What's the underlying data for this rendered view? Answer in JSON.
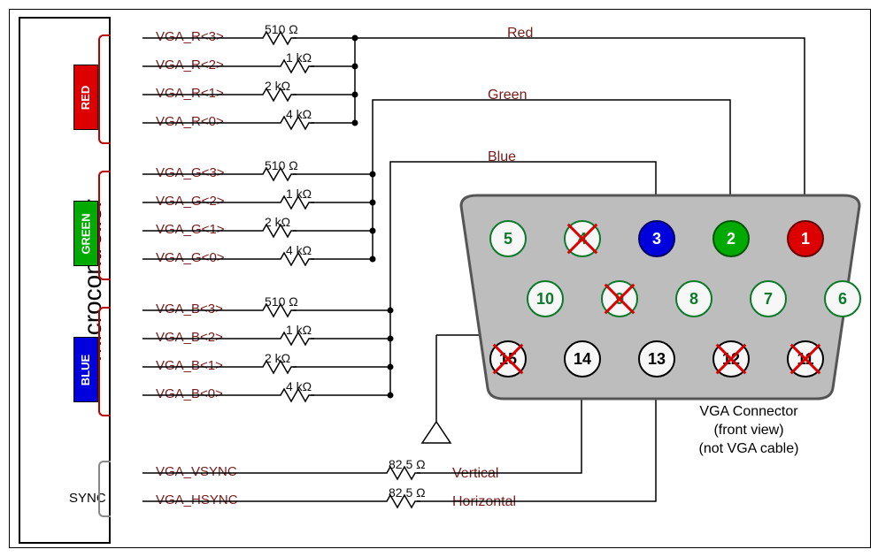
{
  "mcu_label": "microcontroller",
  "sync_label": "SYNC",
  "groups": {
    "red": {
      "badge": "RED"
    },
    "green": {
      "badge": "GREEN"
    },
    "blue": {
      "badge": "BLUE"
    }
  },
  "signals": {
    "r3": "VGA_R<3>",
    "r2": "VGA_R<2>",
    "r1": "VGA_R<1>",
    "r0": "VGA_R<0>",
    "g3": "VGA_G<3>",
    "g2": "VGA_G<2>",
    "g1": "VGA_G<1>",
    "g0": "VGA_G<0>",
    "b3": "VGA_B<3>",
    "b2": "VGA_B<2>",
    "b1": "VGA_B<1>",
    "b0": "VGA_B<0>",
    "vs": "VGA_VSYNC",
    "hs": "VGA_HSYNC"
  },
  "resistors": {
    "r510": "510 Ω",
    "r1k": "1 kΩ",
    "r2k": "2 kΩ",
    "r4k": "4 kΩ",
    "r82a": "82.5 Ω",
    "r82b": "82.5 Ω"
  },
  "lines": {
    "red": "Red",
    "green": "Green",
    "blue": "Blue",
    "vertical": "Vertical",
    "horizontal": "Horizontal"
  },
  "connector": {
    "caption1": "VGA Connector",
    "caption2": "(front view)",
    "caption3": "(not VGA cable)",
    "pins": {
      "1": "1",
      "2": "2",
      "3": "3",
      "4": "4",
      "5": "5",
      "6": "6",
      "7": "7",
      "8": "8",
      "9": "9",
      "10": "10",
      "11": "11",
      "12": "12",
      "13": "13",
      "14": "14",
      "15": "15"
    }
  }
}
